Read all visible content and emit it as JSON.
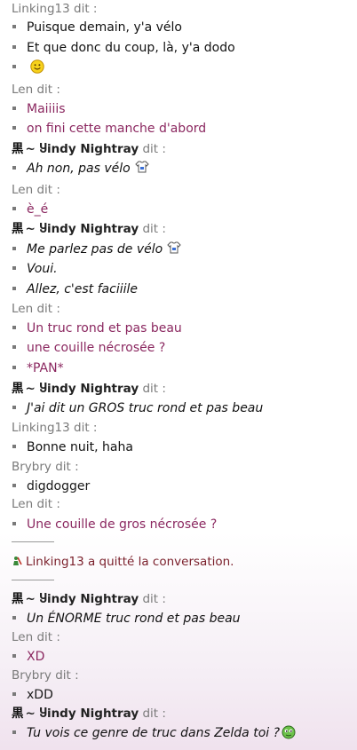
{
  "colors": {
    "header_gray": "#7a7a7a",
    "len_text": "#8b2860",
    "system_text": "#7a1f2a",
    "background_bottom": "#f0e2ee"
  },
  "names": {
    "linking": "Linking13",
    "len": "Len",
    "windy_kanji": "黒",
    "windy": "~ Ⴘindy Nightray",
    "brybry": "Brybry",
    "said_suffix": " dit :"
  },
  "messages": {
    "m1": "Puisque demain, y'a vélo",
    "m2": "Et que donc du coup, là, y'a dodo",
    "m4": "Maiiiis",
    "m5": "on fini cette manche d'abord",
    "m6": "Ah non, pas vélo",
    "m7": "è_é",
    "m8": "Me parlez pas de vélo",
    "m9": "Voui.",
    "m10": "Allez, c'est faciiile",
    "m11": "Un truc rond et pas beau",
    "m12": "une couille nécrosée ?",
    "m13": "*PAN*",
    "m14": "J'ai dit un GROS truc rond et pas beau",
    "m15": "Bonne nuit, haha",
    "m16": "digdogger",
    "m17": "Une couille de gros nécrosée ?",
    "m18": "Un ÉNORME truc rond et pas beau",
    "m19": "XD",
    "m20": "xDD",
    "m21": "Tu vois ce genre de truc dans Zelda toi ?"
  },
  "system": {
    "left_conversation": "Linking13 a quitté la conversation."
  },
  "icons": {
    "smiley": "smiley-icon",
    "shirt": "shirt-emoticon-icon",
    "leave": "leave-conversation-icon",
    "alien": "green-face-emoticon-icon"
  }
}
